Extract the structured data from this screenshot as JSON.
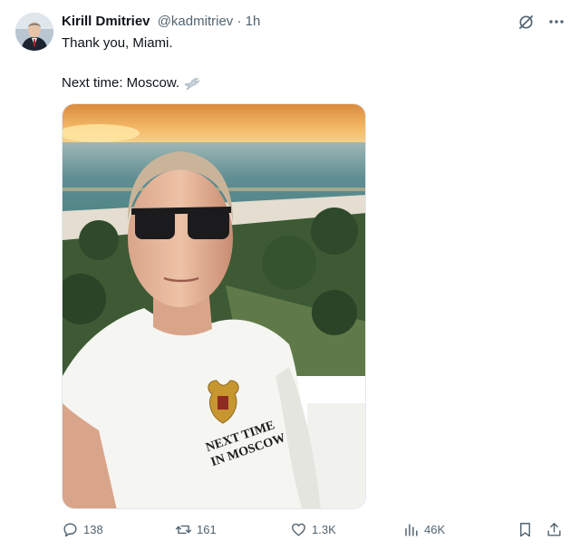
{
  "tweet": {
    "author_name": "Kirill Dmitriev",
    "handle": "@kadmitriev",
    "separator": "·",
    "time": "1h",
    "line1": "Thank you, Miami.",
    "line2": "Next time: Moscow.",
    "shirt_text_1": "NEXT TIME",
    "shirt_text_2": "IN MOSCOW"
  },
  "metrics": {
    "replies": "138",
    "reposts": "161",
    "likes": "1.3K",
    "views": "46K"
  },
  "icons": {
    "grok": "grok-slash-circle-icon",
    "more": "more-dots-icon",
    "reply": "reply-bubble-icon",
    "repost": "repost-arrows-icon",
    "like": "heart-icon",
    "views": "analytics-bars-icon",
    "bookmark": "bookmark-icon",
    "share": "share-upload-icon"
  },
  "colors": {
    "text": "#0f1419",
    "secondary": "#536471"
  }
}
